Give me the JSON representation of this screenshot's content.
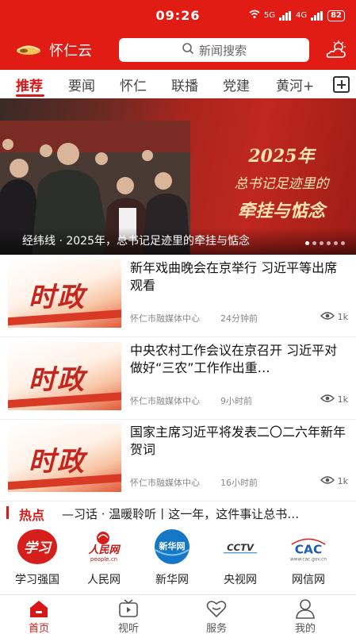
{
  "status_bar": {
    "time": "09:26",
    "network_1": "5G",
    "network_2": "4G",
    "battery": "82"
  },
  "header": {
    "brand": "怀仁云",
    "search_placeholder": "新闻搜索"
  },
  "tabs": [
    {
      "label": "推荐",
      "active": true
    },
    {
      "label": "要闻"
    },
    {
      "label": "怀仁"
    },
    {
      "label": "联播"
    },
    {
      "label": "党建"
    },
    {
      "label": "黄河+"
    }
  ],
  "hero": {
    "title_line1": "2025年",
    "title_line2": "总书记足迹里的",
    "title_line3": "牵挂与惦念",
    "caption": "经纬线 · 2025年，总书记足迹里的牵挂与惦念",
    "slide_count": 6,
    "active_slide": 1
  },
  "news": [
    {
      "thumb_text": "时政",
      "title": "新年戏曲晚会在京举行 习近平等出席观看",
      "source": "怀仁市融媒体中心",
      "time": "24分钟前",
      "views": "1k"
    },
    {
      "thumb_text": "时政",
      "title": "中央农村工作会议在京召开 习近平对做好“三农”工作作出重…",
      "source": "怀仁市融媒体中心",
      "time": "9小时前",
      "views": "1k"
    },
    {
      "thumb_text": "时政",
      "title": "国家主席习近平将发表二〇二六年新年贺词",
      "source": "怀仁市融媒体中心",
      "time": "16小时前",
      "views": "1k"
    }
  ],
  "hot": {
    "label": "热点",
    "text": "—习话 · 温暖聆听丨这一年，这件事让总书…"
  },
  "sites": [
    {
      "label": "学习强国",
      "logo": "学习"
    },
    {
      "label": "人民网",
      "logo": "人民网",
      "sub": "people.cn"
    },
    {
      "label": "新华网",
      "logo": "新华网"
    },
    {
      "label": "央视网",
      "logo": "CCTV"
    },
    {
      "label": "网信网",
      "logo": "CAC",
      "sub": "www.cac.gov.cn"
    }
  ],
  "bottom_nav": [
    {
      "label": "首页",
      "icon": "home-icon",
      "active": true
    },
    {
      "label": "视听",
      "icon": "tv-icon"
    },
    {
      "label": "服务",
      "icon": "heart-icon"
    },
    {
      "label": "我的",
      "icon": "user-icon"
    }
  ],
  "colors": {
    "brand_red": "#e01c14",
    "accent_red": "#d71a18"
  }
}
